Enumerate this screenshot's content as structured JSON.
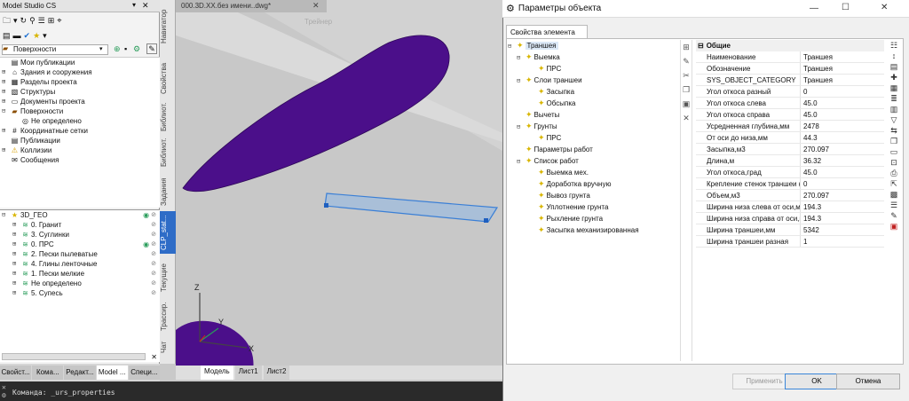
{
  "app": {
    "panel_title": "Model Studio CS"
  },
  "left_toolbar": {
    "view_dropdown": "Поверхности"
  },
  "tree_top": [
    {
      "label": "Мои публикации",
      "icon": "publication-icon",
      "expandable": false
    },
    {
      "label": "Здания и сооружения",
      "icon": "building-icon",
      "expandable": true
    },
    {
      "label": "Разделы проекта",
      "icon": "sections-icon",
      "expandable": true
    },
    {
      "label": "Структуры",
      "icon": "structure-icon",
      "expandable": true
    },
    {
      "label": "Документы проекта",
      "icon": "document-icon",
      "expandable": true
    },
    {
      "label": "Поверхности",
      "icon": "surface-icon",
      "expandable": true,
      "expanded": true
    },
    {
      "label": "Не определено",
      "icon": "undefined-icon",
      "expandable": false,
      "child": true
    },
    {
      "label": "Координатные сетки",
      "icon": "grid-icon",
      "expandable": true
    },
    {
      "label": "Публикации",
      "icon": "publication-icon",
      "expandable": false
    },
    {
      "label": "Коллизии",
      "icon": "warning-icon",
      "expandable": true
    },
    {
      "label": "Сообщения",
      "icon": "message-icon",
      "expandable": false
    }
  ],
  "tree_surfaces": {
    "root": "3D_ГЕО",
    "items": [
      "0. Гранит",
      "3. Суглинки",
      "0. ПРС",
      "2. Пески пылеватые",
      "4. Глины ленточные",
      "1. Пески мелкие",
      "Не определено",
      "5. Супесь"
    ]
  },
  "bottom_tabs": [
    "Свойст...",
    "Кома...",
    "Редакт...",
    "Model ...",
    "Специ..."
  ],
  "bottom_tab_active": "Model ...",
  "vertical_tabs": [
    "Навигатор",
    "Свойства",
    "Библиот.",
    "Библиот.",
    "Задания",
    "CLP_stat...",
    "Текущие",
    "Трассир.",
    "Чат"
  ],
  "document_tab": "000.3D.XX.без имени..dwg*",
  "viewport_overlay": "Трейнер",
  "layout_tabs": [
    "Модель",
    "Лист1",
    "Лист2"
  ],
  "layout_tab_active": "Модель",
  "command_line": "Команда: _urs_properties",
  "dialog": {
    "title": "Параметры объекта",
    "tab": "Свойства элемента",
    "operations_root": "Траншея",
    "operations": [
      {
        "label": "Выемка",
        "level": 1,
        "expandable": true
      },
      {
        "label": "ПРС",
        "level": 2,
        "expandable": false
      },
      {
        "label": "Слои траншеи",
        "level": 1,
        "expandable": true
      },
      {
        "label": "Засыпка",
        "level": 2,
        "expandable": false
      },
      {
        "label": "Обсыпка",
        "level": 2,
        "expandable": false
      },
      {
        "label": "Вычеты",
        "level": 1,
        "expandable": false
      },
      {
        "label": "Грунты",
        "level": 1,
        "expandable": true
      },
      {
        "label": "ПРС",
        "level": 2,
        "expandable": false
      },
      {
        "label": "Параметры работ",
        "level": 1,
        "expandable": false
      },
      {
        "label": "Список работ",
        "level": 1,
        "expandable": true
      },
      {
        "label": "Выемка мех.",
        "level": 2,
        "expandable": false
      },
      {
        "label": "Доработка вручную",
        "level": 2,
        "expandable": false
      },
      {
        "label": "Вывоз грунта",
        "level": 2,
        "expandable": false
      },
      {
        "label": "Уплотнение грунта",
        "level": 2,
        "expandable": false
      },
      {
        "label": "Рыхление грунта",
        "level": 2,
        "expandable": false
      },
      {
        "label": "Засыпка механизированная",
        "level": 2,
        "expandable": false
      }
    ],
    "props_header": "Общие",
    "properties": [
      {
        "name": "Наименование",
        "value": "Траншея"
      },
      {
        "name": "Обозначение",
        "value": "Траншея"
      },
      {
        "name": "SYS_OBJECT_CATEGORY",
        "value": "Траншея"
      },
      {
        "name": "Угол откоса разный",
        "value": "0"
      },
      {
        "name": "Угол откоса слева",
        "value": "45.0"
      },
      {
        "name": "Угол откоса справа",
        "value": "45.0"
      },
      {
        "name": "Усредненная глубина,мм",
        "value": "2478"
      },
      {
        "name": "От оси до низа,мм",
        "value": "44.3"
      },
      {
        "name": "Засыпка,м3",
        "value": "270.097"
      },
      {
        "name": "Длина,м",
        "value": "36.32"
      },
      {
        "name": "Угол откоса,град",
        "value": "45.0"
      },
      {
        "name": "Крепление стенок траншеи (0...",
        "value": "0"
      },
      {
        "name": "Объем,м3",
        "value": "270.097"
      },
      {
        "name": "Ширина низа слева от оси,мм",
        "value": "194.3"
      },
      {
        "name": "Ширина низа справа от оси,мм",
        "value": "194.3"
      },
      {
        "name": "Ширина траншеи,мм",
        "value": "5342"
      },
      {
        "name": "Ширина траншеи разная",
        "value": "1"
      }
    ],
    "buttons": {
      "apply": "Применить",
      "ok": "OK",
      "cancel": "Отмена"
    }
  },
  "colors": {
    "surface": "#4b0f8a",
    "trench_outline": "#3a7fd6",
    "accent": "#2a9d5b"
  }
}
